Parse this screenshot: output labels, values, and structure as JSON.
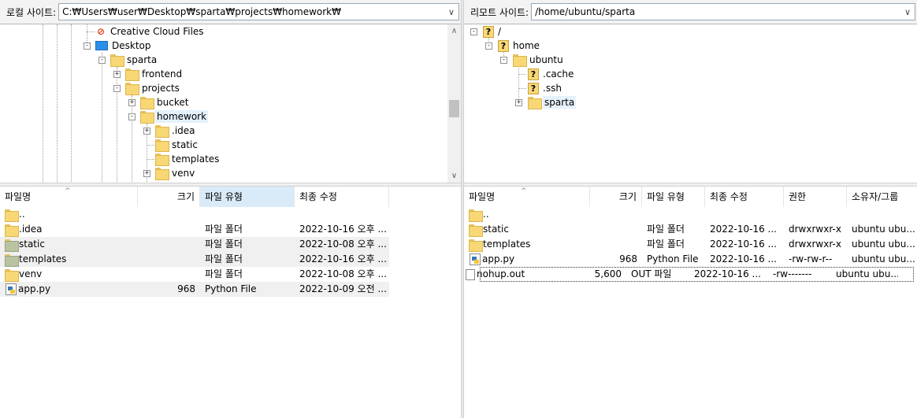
{
  "local": {
    "label": "로컬 사이트:",
    "path": "C:₩Users₩user₩Desktop₩sparta₩projects₩homework₩",
    "tree": [
      {
        "label": "Creative Cloud Files",
        "icon": "creative-cloud-icon"
      },
      {
        "label": "Desktop",
        "icon": "desktop-icon",
        "expander": "-"
      },
      {
        "label": "sparta",
        "icon": "folder-icon",
        "expander": "-"
      },
      {
        "label": "frontend",
        "icon": "folder-icon",
        "expander": "+"
      },
      {
        "label": "projects",
        "icon": "folder-icon",
        "expander": "-"
      },
      {
        "label": "bucket",
        "icon": "folder-icon",
        "expander": "+"
      },
      {
        "label": "homework",
        "icon": "folder-icon",
        "expander": "-",
        "selected": true
      },
      {
        "label": ".idea",
        "icon": "folder-icon",
        "expander": "+"
      },
      {
        "label": "static",
        "icon": "folder-icon"
      },
      {
        "label": "templates",
        "icon": "folder-icon"
      },
      {
        "label": "venv",
        "icon": "folder-icon",
        "expander": "+"
      }
    ],
    "columns": {
      "name": "파일명",
      "size": "크기",
      "type": "파일 유형",
      "modified": "최종 수정"
    },
    "files": [
      {
        "name": "..",
        "size": "",
        "type": "",
        "modified": ""
      },
      {
        "name": ".idea",
        "size": "",
        "type": "파일 폴더",
        "modified": "2022-10-16 오후 ..."
      },
      {
        "name": "static",
        "size": "",
        "type": "파일 폴더",
        "modified": "2022-10-08 오후 ..."
      },
      {
        "name": "templates",
        "size": "",
        "type": "파일 폴더",
        "modified": "2022-10-16 오후 ..."
      },
      {
        "name": "venv",
        "size": "",
        "type": "파일 폴더",
        "modified": "2022-10-08 오후 ..."
      },
      {
        "name": "app.py",
        "size": "968",
        "type": "Python File",
        "modified": "2022-10-09 오전 ..."
      }
    ]
  },
  "remote": {
    "label": "리모트 사이트:",
    "path": "/home/ubuntu/sparta",
    "tree": [
      {
        "label": "/",
        "icon": "unknown-folder-icon",
        "expander": "-"
      },
      {
        "label": "home",
        "icon": "unknown-folder-icon",
        "expander": "-"
      },
      {
        "label": "ubuntu",
        "icon": "folder-icon",
        "expander": "-"
      },
      {
        "label": ".cache",
        "icon": "unknown-folder-icon"
      },
      {
        "label": ".ssh",
        "icon": "unknown-folder-icon"
      },
      {
        "label": "sparta",
        "icon": "folder-icon",
        "expander": "+",
        "selected": true
      }
    ],
    "columns": {
      "name": "파일명",
      "size": "크기",
      "type": "파일 유형",
      "modified": "최종 수정",
      "perm": "권한",
      "owner": "소유자/그룹"
    },
    "files": [
      {
        "name": "..",
        "size": "",
        "type": "",
        "modified": "",
        "perm": "",
        "owner": ""
      },
      {
        "name": "static",
        "size": "",
        "type": "파일 폴더",
        "modified": "2022-10-16 ...",
        "perm": "drwxrwxr-x",
        "owner": "ubuntu ubu..."
      },
      {
        "name": "templates",
        "size": "",
        "type": "파일 폴더",
        "modified": "2022-10-16 ...",
        "perm": "drwxrwxr-x",
        "owner": "ubuntu ubu..."
      },
      {
        "name": "app.py",
        "size": "968",
        "type": "Python File",
        "modified": "2022-10-16 ...",
        "perm": "-rw-rw-r--",
        "owner": "ubuntu ubu..."
      },
      {
        "name": "nohup.out",
        "size": "5,600",
        "type": "OUT 파일",
        "modified": "2022-10-16 ...",
        "perm": "-rw-------",
        "owner": "ubuntu ubu..."
      }
    ]
  },
  "glyphs": {
    "unknown": "?",
    "cc": "⊘",
    "dropdown": "∨",
    "scroll_up": "∧",
    "scroll_down": "∨",
    "sort": "^"
  }
}
